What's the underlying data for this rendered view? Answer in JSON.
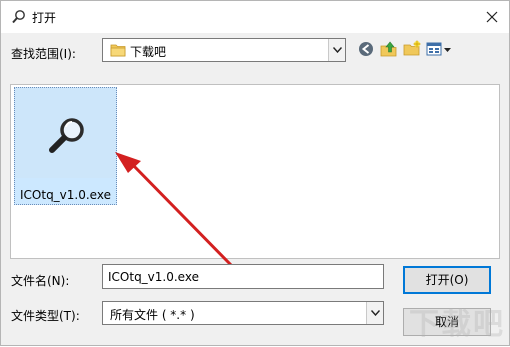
{
  "window": {
    "title": "打开",
    "close_icon": "close-icon"
  },
  "lookin": {
    "label": "查找范围(I):",
    "value": "下载吧",
    "folder_icon": "folder-icon"
  },
  "toolbar": {
    "back_icon": "back-icon",
    "up_icon": "up-folder-icon",
    "new_folder_icon": "new-folder-icon",
    "view_menu_icon": "view-menu-icon"
  },
  "files": [
    {
      "name": "ICOtq_v1.0.exe",
      "icon": "magnifier-icon",
      "selected": true
    }
  ],
  "filename": {
    "label": "文件名(N):",
    "value": "ICOtq_v1.0.exe"
  },
  "filetype": {
    "label": "文件类型(T):",
    "value": "所有文件 ( *.* )"
  },
  "buttons": {
    "open": "打开(O)",
    "cancel": "取消"
  },
  "watermark": "下载吧",
  "colors": {
    "accent": "#0078d7",
    "selection": "#cce8ff",
    "annotation_arrow": "#d32020"
  }
}
